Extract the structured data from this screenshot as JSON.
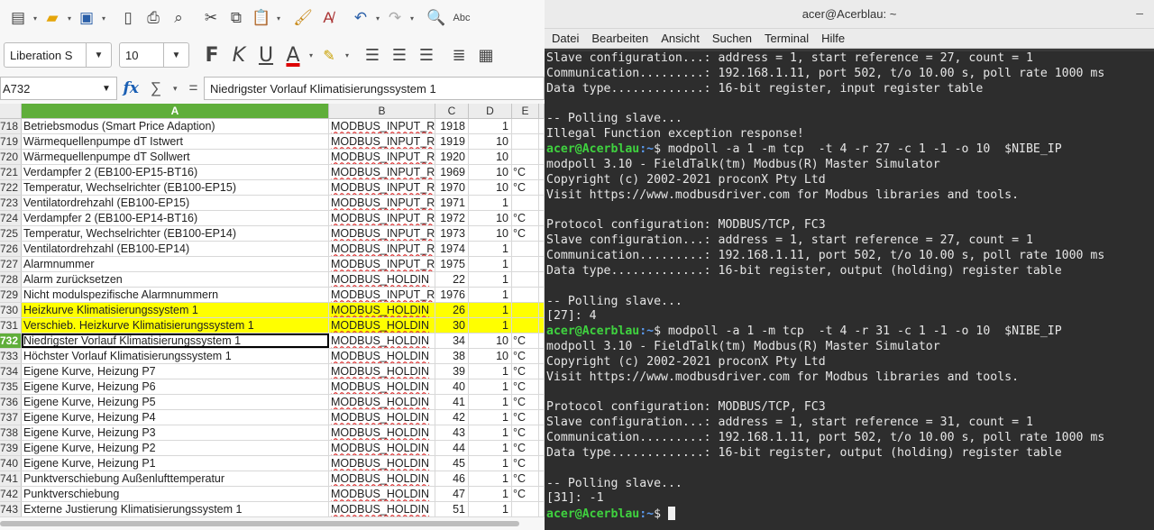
{
  "spreadsheet": {
    "font_name": "Liberation S",
    "font_size": "10",
    "name_box": "A732",
    "formula": "Niedrigster Vorlauf Klimatisierungssystem 1",
    "columns": [
      {
        "label": "",
        "w": 24
      },
      {
        "label": "A",
        "w": 341
      },
      {
        "label": "B",
        "w": 118
      },
      {
        "label": "C",
        "w": 37
      },
      {
        "label": "D",
        "w": 48
      },
      {
        "label": "E",
        "w": 30
      },
      {
        "label": "",
        "w": 6
      }
    ],
    "rows": [
      {
        "num": "718",
        "a": "Betriebsmodus (Smart Price Adaption)",
        "b": "MODBUS_INPUT_R",
        "c": "1918",
        "d": "1",
        "e": ""
      },
      {
        "num": "719",
        "a": "Wärmequellenpumpe dT Istwert",
        "b": "MODBUS_INPUT_R",
        "c": "1919",
        "d": "10",
        "e": ""
      },
      {
        "num": "720",
        "a": "Wärmequellenpumpe dT Sollwert",
        "b": "MODBUS_INPUT_R",
        "c": "1920",
        "d": "10",
        "e": ""
      },
      {
        "num": "721",
        "a": "Verdampfer 2 (EB100-EP15-BT16)",
        "b": "MODBUS_INPUT_R",
        "c": "1969",
        "d": "10",
        "e": "°C"
      },
      {
        "num": "722",
        "a": "Temperatur, Wechselrichter (EB100-EP15)",
        "b": "MODBUS_INPUT_R",
        "c": "1970",
        "d": "10",
        "e": "°C"
      },
      {
        "num": "723",
        "a": "Ventilatordrehzahl (EB100-EP15)",
        "b": "MODBUS_INPUT_R",
        "c": "1971",
        "d": "1",
        "e": ""
      },
      {
        "num": "724",
        "a": "Verdampfer 2 (EB100-EP14-BT16)",
        "b": "MODBUS_INPUT_R",
        "c": "1972",
        "d": "10",
        "e": "°C"
      },
      {
        "num": "725",
        "a": "Temperatur, Wechselrichter (EB100-EP14)",
        "b": "MODBUS_INPUT_R",
        "c": "1973",
        "d": "10",
        "e": "°C"
      },
      {
        "num": "726",
        "a": "Ventilatordrehzahl (EB100-EP14)",
        "b": "MODBUS_INPUT_R",
        "c": "1974",
        "d": "1",
        "e": ""
      },
      {
        "num": "727",
        "a": "Alarmnummer",
        "b": "MODBUS_INPUT_R",
        "c": "1975",
        "d": "1",
        "e": ""
      },
      {
        "num": "728",
        "a": "Alarm zurücksetzen",
        "b": "MODBUS_HOLDIN",
        "c": "22",
        "d": "1",
        "e": ""
      },
      {
        "num": "729",
        "a": "Nicht modulspezifische Alarmnummern",
        "b": "MODBUS_INPUT_R",
        "c": "1976",
        "d": "1",
        "e": ""
      },
      {
        "num": "730",
        "a": "Heizkurve Klimatisierungssystem 1",
        "b": "MODBUS_HOLDIN",
        "c": "26",
        "d": "1",
        "e": "",
        "hl": true
      },
      {
        "num": "731",
        "a": "Verschieb. Heizkurve Klimatisierungssystem 1",
        "b": "MODBUS_HOLDIN",
        "c": "30",
        "d": "1",
        "e": "",
        "hl": true
      },
      {
        "num": "732",
        "a": "Niedrigster Vorlauf Klimatisierungssystem 1",
        "b": "MODBUS_HOLDIN",
        "c": "34",
        "d": "10",
        "e": "°C",
        "active": true
      },
      {
        "num": "733",
        "a": "Höchster Vorlauf Klimatisierungssystem 1",
        "b": "MODBUS_HOLDIN",
        "c": "38",
        "d": "10",
        "e": "°C"
      },
      {
        "num": "734",
        "a": "Eigene Kurve, Heizung P7",
        "b": "MODBUS_HOLDIN",
        "c": "39",
        "d": "1",
        "e": "°C"
      },
      {
        "num": "735",
        "a": "Eigene Kurve, Heizung P6",
        "b": "MODBUS_HOLDIN",
        "c": "40",
        "d": "1",
        "e": "°C"
      },
      {
        "num": "736",
        "a": "Eigene Kurve, Heizung P5",
        "b": "MODBUS_HOLDIN",
        "c": "41",
        "d": "1",
        "e": "°C"
      },
      {
        "num": "737",
        "a": "Eigene Kurve, Heizung P4",
        "b": "MODBUS_HOLDIN",
        "c": "42",
        "d": "1",
        "e": "°C"
      },
      {
        "num": "738",
        "a": "Eigene Kurve, Heizung P3",
        "b": "MODBUS_HOLDIN",
        "c": "43",
        "d": "1",
        "e": "°C"
      },
      {
        "num": "739",
        "a": "Eigene Kurve, Heizung P2",
        "b": "MODBUS_HOLDIN",
        "c": "44",
        "d": "1",
        "e": "°C"
      },
      {
        "num": "740",
        "a": "Eigene Kurve, Heizung P1",
        "b": "MODBUS_HOLDIN",
        "c": "45",
        "d": "1",
        "e": "°C"
      },
      {
        "num": "741",
        "a": "Punktverschiebung Außenlufttemperatur",
        "b": "MODBUS_HOLDIN",
        "c": "46",
        "d": "1",
        "e": "°C"
      },
      {
        "num": "742",
        "a": "Punktverschiebung",
        "b": "MODBUS_HOLDIN",
        "c": "47",
        "d": "1",
        "e": "°C"
      },
      {
        "num": "743",
        "a": "Externe Justierung Klimatisierungssystem 1",
        "b": "MODBUS_HOLDIN",
        "c": "51",
        "d": "1",
        "e": ""
      }
    ]
  },
  "terminal": {
    "title": "acer@Acerblau: ~",
    "menu": [
      "Datei",
      "Bearbeiten",
      "Ansicht",
      "Suchen",
      "Terminal",
      "Hilfe"
    ],
    "prompt_user": "acer@Acerblau",
    "prompt_path": ":~",
    "lines": [
      {
        "t": "Slave configuration...: address = 1, start reference = 27, count = 1"
      },
      {
        "t": "Communication.........: 192.168.1.11, port 502, t/o 10.00 s, poll rate 1000 ms"
      },
      {
        "t": "Data type.............: 16-bit register, input register table"
      },
      {
        "t": ""
      },
      {
        "t": "-- Polling slave..."
      },
      {
        "t": "Illegal Function exception response!"
      },
      {
        "p": true,
        "t": "$ modpoll -a 1 -m tcp  -t 4 -r 27 -c 1 -1 -o 10  $NIBE_IP"
      },
      {
        "t": "modpoll 3.10 - FieldTalk(tm) Modbus(R) Master Simulator"
      },
      {
        "t": "Copyright (c) 2002-2021 proconX Pty Ltd"
      },
      {
        "t": "Visit https://www.modbusdriver.com for Modbus libraries and tools."
      },
      {
        "t": ""
      },
      {
        "t": "Protocol configuration: MODBUS/TCP, FC3"
      },
      {
        "t": "Slave configuration...: address = 1, start reference = 27, count = 1"
      },
      {
        "t": "Communication.........: 192.168.1.11, port 502, t/o 10.00 s, poll rate 1000 ms"
      },
      {
        "t": "Data type.............: 16-bit register, output (holding) register table"
      },
      {
        "t": ""
      },
      {
        "t": "-- Polling slave..."
      },
      {
        "t": "[27]: 4"
      },
      {
        "p": true,
        "t": "$ modpoll -a 1 -m tcp  -t 4 -r 31 -c 1 -1 -o 10  $NIBE_IP"
      },
      {
        "t": "modpoll 3.10 - FieldTalk(tm) Modbus(R) Master Simulator"
      },
      {
        "t": "Copyright (c) 2002-2021 proconX Pty Ltd"
      },
      {
        "t": "Visit https://www.modbusdriver.com for Modbus libraries and tools."
      },
      {
        "t": ""
      },
      {
        "t": "Protocol configuration: MODBUS/TCP, FC3"
      },
      {
        "t": "Slave configuration...: address = 1, start reference = 31, count = 1"
      },
      {
        "t": "Communication.........: 192.168.1.11, port 502, t/o 10.00 s, poll rate 1000 ms"
      },
      {
        "t": "Data type.............: 16-bit register, output (holding) register table"
      },
      {
        "t": ""
      },
      {
        "t": "-- Polling slave..."
      },
      {
        "t": "[31]: -1"
      },
      {
        "p": true,
        "t": "$ ",
        "cursor": true
      }
    ]
  },
  "colors": {
    "highlight": "#ffff00",
    "selection": "#5fae3a",
    "prompt_user": "#3fd23f",
    "prompt_path": "#5b9bf0",
    "terminal_bg": "#2d2d2d"
  }
}
